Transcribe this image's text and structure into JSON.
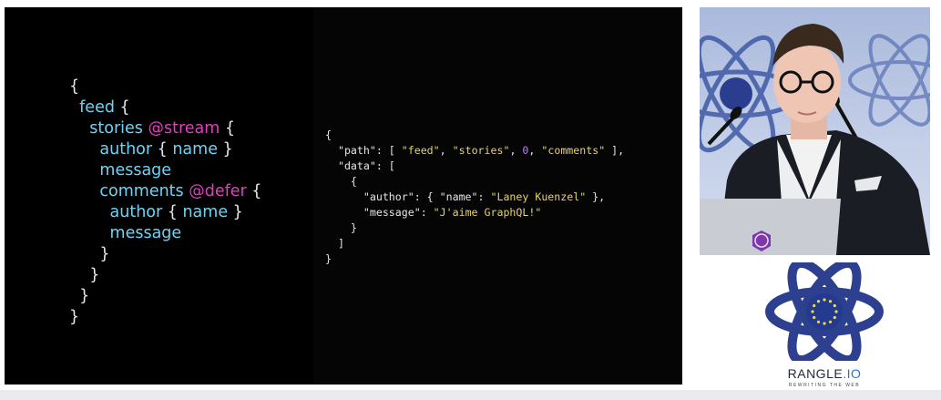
{
  "slide": {
    "graphql_lines": [
      [
        {
          "t": "{",
          "c": "br"
        }
      ],
      [
        {
          "t": "  ",
          "c": "br"
        },
        {
          "t": "feed",
          "c": "kw"
        },
        {
          "t": " {",
          "c": "br"
        }
      ],
      [
        {
          "t": "    ",
          "c": "br"
        },
        {
          "t": "stories",
          "c": "kw"
        },
        {
          "t": " ",
          "c": "br"
        },
        {
          "t": "@stream",
          "c": "dir"
        },
        {
          "t": " {",
          "c": "br"
        }
      ],
      [
        {
          "t": "      ",
          "c": "br"
        },
        {
          "t": "author",
          "c": "kw"
        },
        {
          "t": " { ",
          "c": "br"
        },
        {
          "t": "name",
          "c": "kw"
        },
        {
          "t": " }",
          "c": "br"
        }
      ],
      [
        {
          "t": "      ",
          "c": "br"
        },
        {
          "t": "message",
          "c": "kw"
        }
      ],
      [
        {
          "t": "      ",
          "c": "br"
        },
        {
          "t": "comments",
          "c": "kw"
        },
        {
          "t": " ",
          "c": "br"
        },
        {
          "t": "@defer",
          "c": "dir"
        },
        {
          "t": " {",
          "c": "br"
        }
      ],
      [
        {
          "t": "        ",
          "c": "br"
        },
        {
          "t": "author",
          "c": "kw"
        },
        {
          "t": " { ",
          "c": "br"
        },
        {
          "t": "name",
          "c": "kw"
        },
        {
          "t": " }",
          "c": "br"
        }
      ],
      [
        {
          "t": "        ",
          "c": "br"
        },
        {
          "t": "message",
          "c": "kw"
        }
      ],
      [
        {
          "t": "      }",
          "c": "br"
        }
      ],
      [
        {
          "t": "    }",
          "c": "br"
        }
      ],
      [
        {
          "t": "  }",
          "c": "br"
        }
      ],
      [
        {
          "t": "}",
          "c": "br"
        }
      ]
    ],
    "json_lines": [
      [
        {
          "t": "{",
          "c": "p"
        }
      ],
      [
        {
          "t": "  \"path\": [ ",
          "c": "p"
        },
        {
          "t": "\"feed\"",
          "c": "str"
        },
        {
          "t": ", ",
          "c": "p"
        },
        {
          "t": "\"stories\"",
          "c": "str"
        },
        {
          "t": ", ",
          "c": "p"
        },
        {
          "t": "0",
          "c": "num"
        },
        {
          "t": ", ",
          "c": "p"
        },
        {
          "t": "\"comments\"",
          "c": "str"
        },
        {
          "t": " ],",
          "c": "p"
        }
      ],
      [
        {
          "t": "  \"data\": [",
          "c": "p"
        }
      ],
      [
        {
          "t": "    {",
          "c": "p"
        }
      ],
      [
        {
          "t": "      \"author\": { \"name\": ",
          "c": "p"
        },
        {
          "t": "\"Laney Kuenzel\"",
          "c": "str"
        },
        {
          "t": " },",
          "c": "p"
        }
      ],
      [
        {
          "t": "      \"message\": ",
          "c": "p"
        },
        {
          "t": "\"J'aime GraphQL!\"",
          "c": "str"
        }
      ],
      [
        {
          "t": "    }",
          "c": "p"
        }
      ],
      [
        {
          "t": "  ]",
          "c": "p"
        }
      ],
      [
        {
          "t": "}",
          "c": "p"
        }
      ]
    ]
  },
  "sponsor": {
    "name_main": "RANGLE",
    "name_suffix": ".IO",
    "tagline": "REWRITING THE WEB"
  },
  "colors": {
    "keyword": "#6fd3f5",
    "directive": "#e23fbf",
    "string": "#e7d26b",
    "number": "#b884e8",
    "logo_blue": "#2d3f8f"
  }
}
